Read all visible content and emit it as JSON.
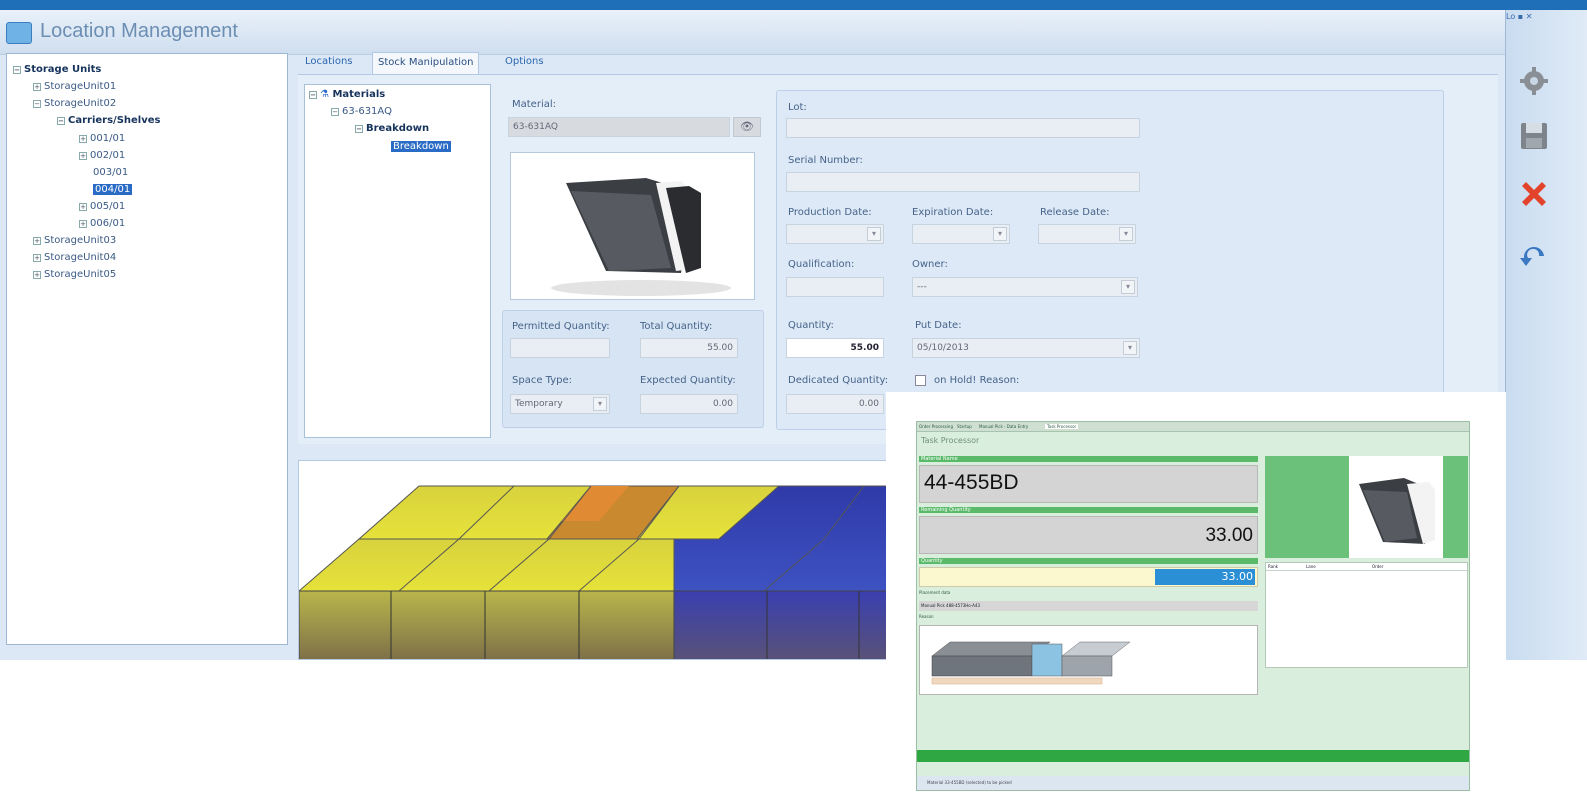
{
  "app": {
    "title": "Location Management"
  },
  "location_tree": [
    {
      "label": "Storage Units",
      "bold": true,
      "pm": "⊟"
    },
    {
      "label": "StorageUnit01",
      "pm": "⊞"
    },
    {
      "label": "StorageUnit02",
      "pm": "⊟"
    },
    {
      "label": "Carriers/Shelves",
      "bold": true,
      "pm": "⊟"
    },
    {
      "label": "001/01",
      "pm": "⊞"
    },
    {
      "label": "002/01",
      "pm": "⊞"
    },
    {
      "label": "003/01",
      "pm": ""
    },
    {
      "label": "004/01",
      "pm": "",
      "selected": true
    },
    {
      "label": "005/01",
      "pm": "⊞"
    },
    {
      "label": "006/01",
      "pm": "⊞"
    },
    {
      "label": "StorageUnit03",
      "pm": "⊞"
    },
    {
      "label": "StorageUnit04",
      "pm": "⊞"
    },
    {
      "label": "StorageUnit05",
      "pm": "⊞"
    }
  ],
  "tabs": [
    "Locations",
    "Stock Manipulation",
    "Options"
  ],
  "material_tree": [
    {
      "label": "Materials",
      "bold": true
    },
    {
      "label": "63-631AQ"
    },
    {
      "label": "Breakdown",
      "bold": true
    },
    {
      "label": "Breakdown",
      "selected": true
    }
  ],
  "form": {
    "material_label": "Material:",
    "material_value": "63-631AQ",
    "permitted_qty_label": "Permitted Quantity:",
    "total_qty_label": "Total Quantity:",
    "total_qty_value": "55.00",
    "space_type_label": "Space Type:",
    "space_type_value": "Temporary",
    "expected_qty_label": "Expected Quantity:",
    "expected_qty_value": "0.00",
    "lot_label": "Lot:",
    "serial_label": "Serial Number:",
    "production_date_label": "Production Date:",
    "expiration_date_label": "Expiration Date:",
    "release_date_label": "Release Date:",
    "qualification_label": "Qualification:",
    "owner_label": "Owner:",
    "owner_value": "---",
    "quantity_label": "Quantity:",
    "quantity_value": "55.00",
    "put_date_label": "Put Date:",
    "put_date_value": "05/10/2013",
    "dedicated_qty_label": "Dedicated Quantity:",
    "dedicated_qty_value": "0.00",
    "on_hold_label": "on Hold! Reason:"
  },
  "sidebar": {
    "window_controls": "Lo ▪ ✕"
  },
  "task_processor": {
    "tabs": [
      "Order Processing",
      "Startup",
      "Manual Pick - Data Entry",
      "Task Processor"
    ],
    "title": "Task Processor",
    "material_name_label": "Material Name",
    "material_name_value": "44-455BD",
    "remaining_qty_label": "Remaining Quantity",
    "remaining_qty_value": "33.00",
    "quantity_label": "Quantity",
    "quantity_value": "33.00",
    "placement_label": "Placement data",
    "placement_value": "Manual Pick 488-4573Ho-A43",
    "reason_label": "Reason",
    "list_headers": [
      "Rank",
      "Lane",
      "Order"
    ],
    "status_text": "Material 33-455BD (selected) to be picked"
  },
  "colors": {
    "accent": "#1f6fb8",
    "selected": "#2a6bc5",
    "tp_green": "#5aba6a"
  }
}
